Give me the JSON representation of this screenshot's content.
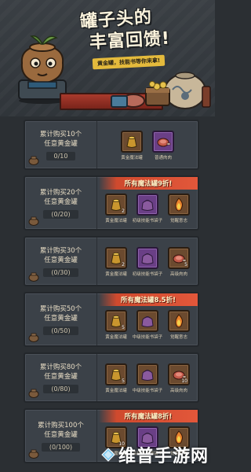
{
  "header": {
    "title_line1": "罐子头的",
    "title_line2": "丰富回馈!",
    "subtitle": "黄金罐，技能书等你来拿!"
  },
  "tiers": [
    {
      "req_line1": "累计购买10个",
      "req_line2": "任意黄金罐",
      "progress": "0/10",
      "banner": "",
      "rewards": [
        {
          "name": "黄金魔法罐",
          "icon": "golden-jar-icon",
          "qty": "",
          "slot": "brown"
        },
        {
          "name": "普通肉肉",
          "icon": "meat-icon",
          "qty": "",
          "slot": "purple"
        }
      ]
    },
    {
      "req_line1": "累计购买20个",
      "req_line2": "任意黄金罐",
      "progress": "(0/20)",
      "banner": "所有魔法罐9折!",
      "rewards": [
        {
          "name": "黄金魔法罐",
          "icon": "golden-jar-icon",
          "qty": "2",
          "slot": "brown"
        },
        {
          "name": "初级技能书袋子",
          "icon": "book-bag-icon",
          "qty": "",
          "slot": "purple"
        },
        {
          "name": "觉醒意志",
          "icon": "flame-will-icon",
          "qty": "",
          "slot": "brown"
        }
      ]
    },
    {
      "req_line1": "累计购买30个",
      "req_line2": "任意黄金罐",
      "progress": "(0/30)",
      "banner": "",
      "rewards": [
        {
          "name": "黄金魔法罐",
          "icon": "golden-jar-icon",
          "qty": "2",
          "slot": "brown"
        },
        {
          "name": "初级技能书袋子",
          "icon": "book-bag-icon",
          "qty": "",
          "slot": "purple"
        },
        {
          "name": "高级肉肉",
          "icon": "meat-icon",
          "qty": "5",
          "slot": "brown"
        }
      ]
    },
    {
      "req_line1": "累计购买50个",
      "req_line2": "任意黄金罐",
      "progress": "(0/50)",
      "banner": "所有魔法罐8.5折!",
      "rewards": [
        {
          "name": "黄金魔法罐",
          "icon": "golden-jar-icon",
          "qty": "5",
          "slot": "brown"
        },
        {
          "name": "中级技能书袋子",
          "icon": "book-bag-icon",
          "qty": "",
          "slot": "brown"
        },
        {
          "name": "觉醒意志",
          "icon": "flame-will-icon",
          "qty": "",
          "slot": "brown"
        }
      ]
    },
    {
      "req_line1": "累计购买80个",
      "req_line2": "任意黄金罐",
      "progress": "(0/80)",
      "banner": "",
      "rewards": [
        {
          "name": "黄金魔法罐",
          "icon": "golden-jar-icon",
          "qty": "5",
          "slot": "brown"
        },
        {
          "name": "中级技能书袋子",
          "icon": "book-bag-icon",
          "qty": "",
          "slot": "brown"
        },
        {
          "name": "高级肉肉",
          "icon": "meat-icon",
          "qty": "10",
          "slot": "brown"
        }
      ]
    },
    {
      "req_line1": "累计购买100个",
      "req_line2": "任意黄金罐",
      "progress": "(0/100)",
      "banner": "所有魔法罐8折!",
      "rewards": [
        {
          "name": "黄金魔法罐",
          "icon": "golden-jar-icon",
          "qty": "10",
          "slot": "brown"
        },
        {
          "name": "高级技能书袋子",
          "icon": "book-bag-icon",
          "qty": "",
          "slot": "purple"
        },
        {
          "name": "觉醒意志",
          "icon": "flame-will-icon",
          "qty": "",
          "slot": "brown"
        }
      ]
    }
  ],
  "watermark": "维普手游网",
  "colors": {
    "background": "#2b2f33",
    "panel": "#3b4148",
    "banner": "#e2573a",
    "slot_brown": "#6b4a2f",
    "slot_purple": "#6a3f86",
    "accent_gold": "#e4ba3c"
  }
}
